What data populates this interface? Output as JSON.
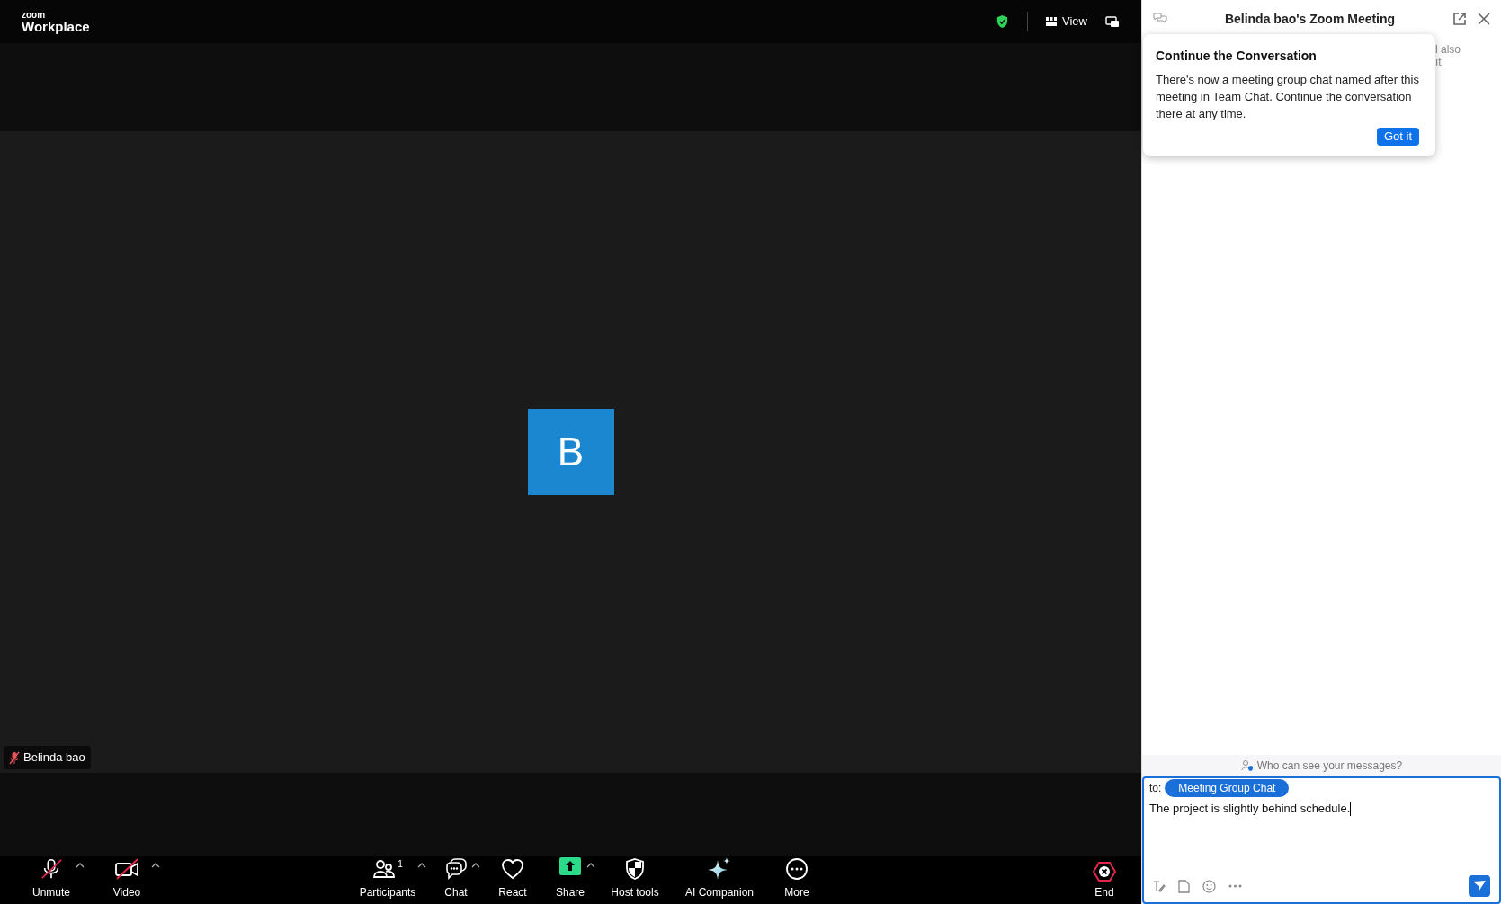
{
  "app": {
    "brand_small": "zoom",
    "brand": "Workplace",
    "view_button": "View"
  },
  "participant": {
    "initial": "B",
    "name": "Belinda bao",
    "muted": true
  },
  "toolbar": [
    {
      "kind": "mic",
      "label": "Unmute",
      "off": true,
      "caret": true
    },
    {
      "kind": "video",
      "label": "Video",
      "off": true,
      "caret": true
    },
    {
      "kind": "participants",
      "label": "Participants",
      "count": "1",
      "caret": true
    },
    {
      "kind": "chat",
      "label": "Chat",
      "caret": true
    },
    {
      "kind": "react",
      "label": "React",
      "caret": false
    },
    {
      "kind": "share",
      "label": "Share",
      "caret": true
    },
    {
      "kind": "host",
      "label": "Host tools",
      "caret": false
    },
    {
      "kind": "ai",
      "label": "AI Companion",
      "caret": false
    },
    {
      "kind": "more",
      "label": "More",
      "caret": false
    }
  ],
  "end_button": "End",
  "chat_panel": {
    "title": "Belinda bao's Zoom Meeting",
    "background_fragments": [
      "l also",
      "ıt"
    ],
    "popover": {
      "title": "Continue the Conversation",
      "text": "There's now a meeting group chat named after this meeting in Team Chat. Continue the conversation there at any time.",
      "button": "Got it"
    },
    "privacy_link": "Who can see your messages?",
    "to_label": "to:",
    "recipient": "Meeting Group Chat",
    "message": "The project is slightly behind schedule."
  }
}
